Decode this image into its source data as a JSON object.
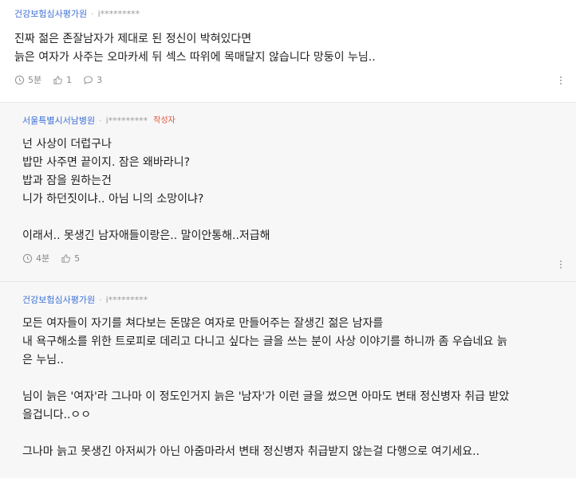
{
  "comments": [
    {
      "author": "건강보험심사평가원",
      "user_id": "i*********",
      "writer_badge": "",
      "lines": [
        "진짜 젊은 존잘남자가 제대로 된 정신이 박혀있다면",
        "늙은 여자가 사주는 오마카세 뒤 섹스 따위에 목매달지 않습니다 망둥이 누님.."
      ],
      "time": "5분",
      "likes": "1",
      "replies": "3"
    },
    {
      "author": "서울특별시서남병원",
      "user_id": "i*********",
      "writer_badge": "작성자",
      "lines": [
        "넌 사상이 더럽구나",
        "밥만 사주면 끝이지. 잠은 왜바라니?",
        "밥과 잠을 원하는건",
        "니가 하던짓이냐.. 아님 니의 소망이냐?",
        "",
        "이래서.. 못생긴 남자애들이랑은.. 말이안통해..저급해"
      ],
      "time": "4분",
      "likes": "5"
    },
    {
      "author": "건강보험심사평가원",
      "user_id": "i*********",
      "writer_badge": "",
      "lines": [
        "모든 여자들이 자기를 쳐다보는 돈많은 여자로 만들어주는 잘생긴 젊은 남자를",
        "내 욕구해소를 위한 트로피로 데리고 다니고 싶다는 글을 쓰는 분이 사상 이야기를 하니까 좀 우습네요 늙",
        "은 누님..",
        "",
        "님이 늙은 '여자'라 그나마 이 정도인거지 늙은 '남자'가 이런 글을 썼으면 아마도 변태 정신병자 취급 받았",
        "을겁니다..ㅇㅇ",
        "",
        "그나마 늙고 못생긴 아저씨가 아닌 아줌마라서 변태 정신병자 취급받지 않는걸 다행으로 여기세요.."
      ]
    }
  ]
}
